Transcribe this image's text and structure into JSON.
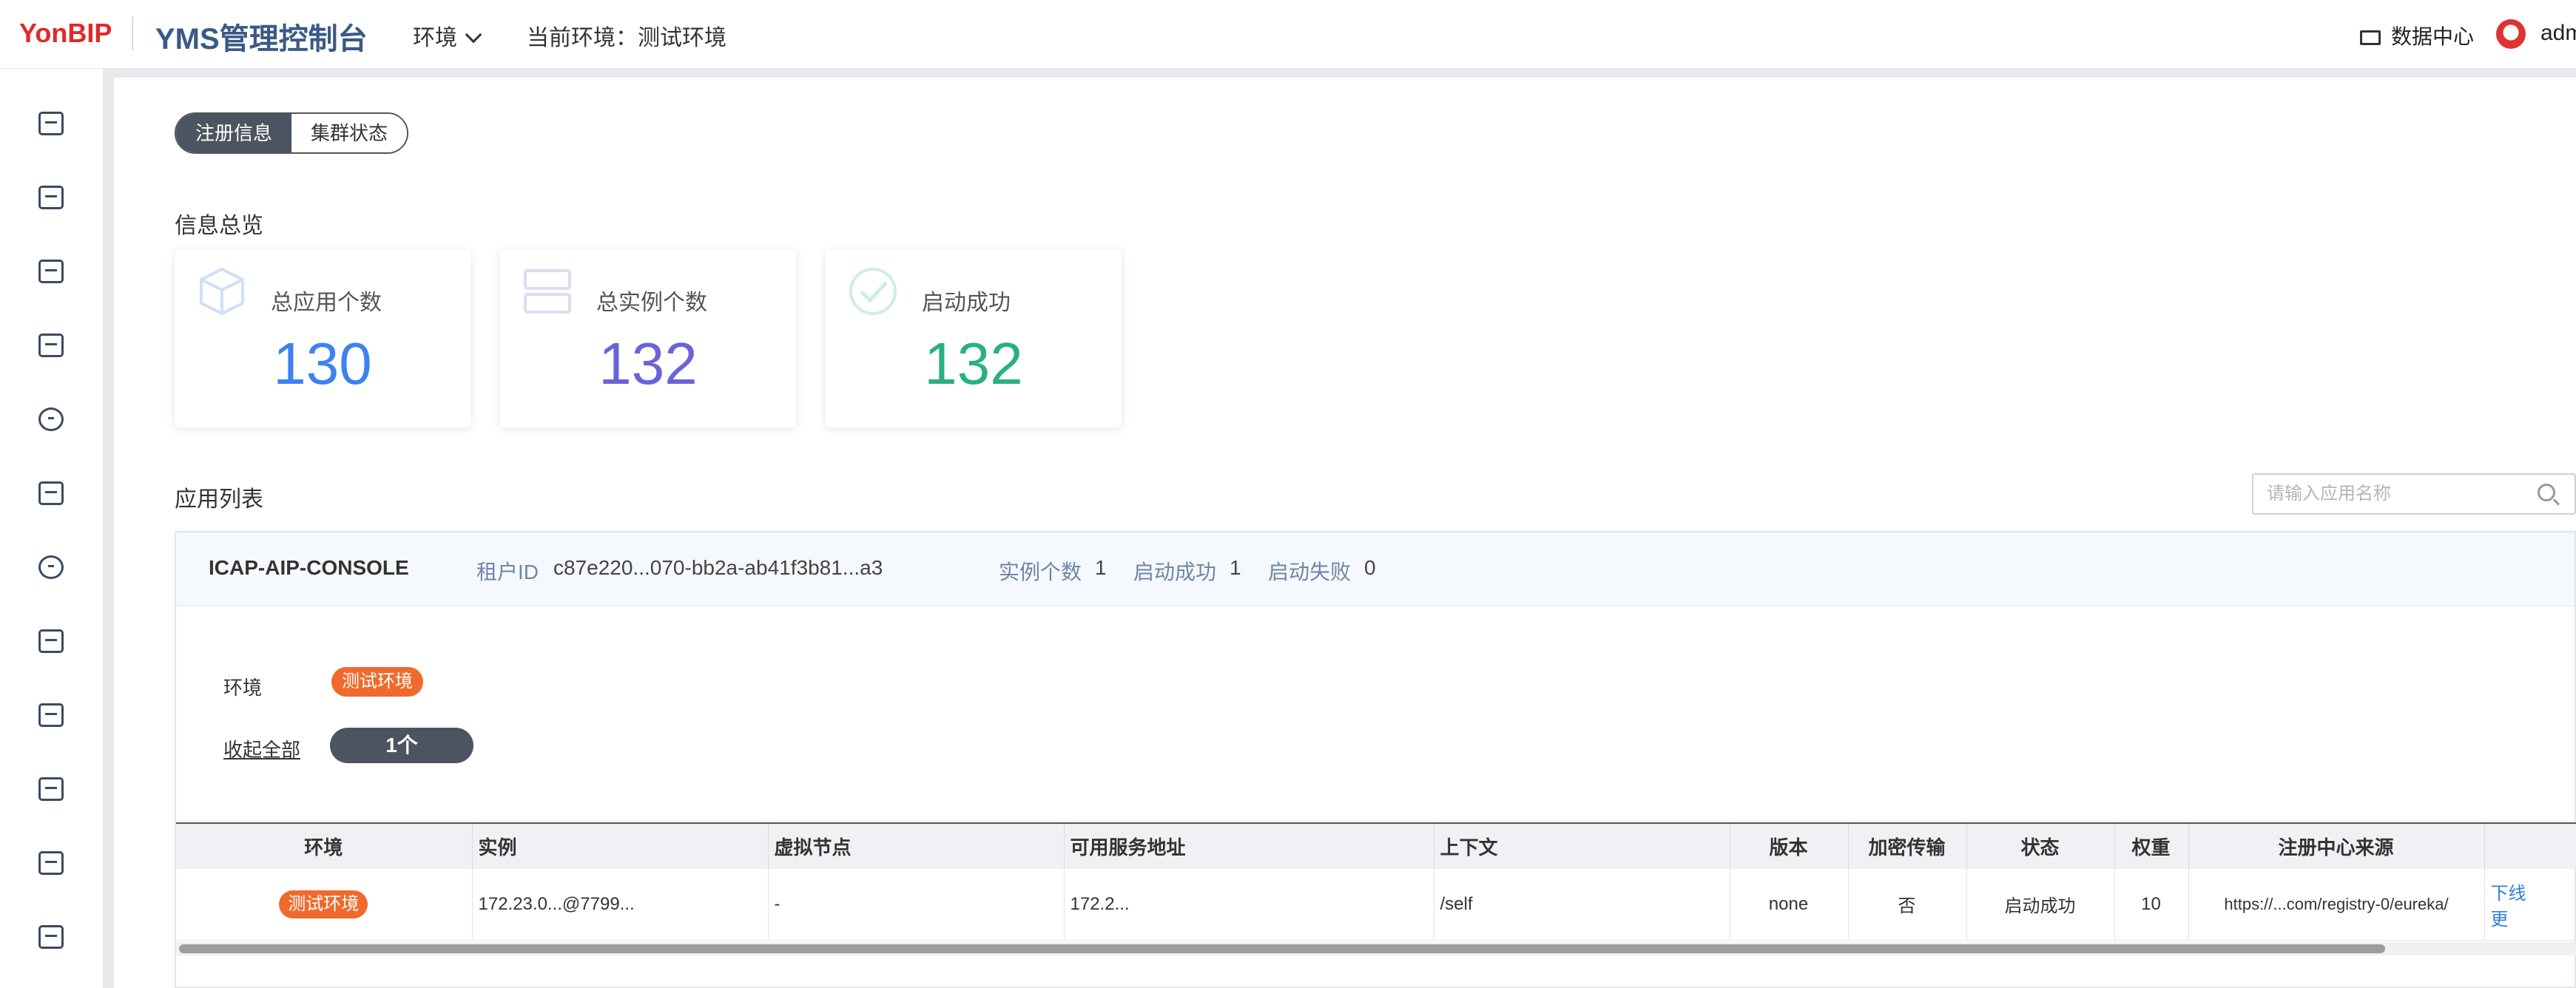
{
  "header": {
    "logo_text": "YonBIP",
    "app_title": "YMS管理控制台",
    "env_menu_label": "环境",
    "current_env_label": "当前环境：测试环境",
    "data_center_label": "数据中心",
    "user_label": "adm"
  },
  "sidebar": {
    "icons": [
      "monitor-icon",
      "chip-settings-icon",
      "server-icon",
      "layers-icon",
      "leaf-icon",
      "list-icon",
      "cluster-icon",
      "search-list-icon",
      "table-icon",
      "sliders-icon",
      "document-icon",
      "chart-icon"
    ]
  },
  "tabs": [
    {
      "label": "注册信息",
      "active": true
    },
    {
      "label": "集群状态",
      "active": false
    }
  ],
  "overview": {
    "title": "信息总览",
    "cards": [
      {
        "label": "总应用个数",
        "value": "130",
        "color": "#3d82f0",
        "icon": "cube-icon"
      },
      {
        "label": "总实例个数",
        "value": "132",
        "color": "#6a63d8",
        "icon": "server-stack-icon"
      },
      {
        "label": "启动成功",
        "value": "132",
        "color": "#2bb07f",
        "icon": "check-circle-icon"
      }
    ]
  },
  "app_list": {
    "title": "应用列表",
    "search_placeholder": "请输入应用名称"
  },
  "app": {
    "name": "ICAP-AIP-CONSOLE",
    "tenant_label": "租户ID",
    "tenant_value": "c87e220...070-bb2a-ab41f3b81...a3",
    "instances_label": "实例个数",
    "instances_value": "1",
    "success_label": "启动成功",
    "success_value": "1",
    "fail_label": "启动失败",
    "fail_value": "0",
    "env_label": "环境",
    "env_tag": "测试环境",
    "collapse_label": "收起全部",
    "count_pill": "1个"
  },
  "table": {
    "headers": [
      "环境",
      "实例",
      "虚拟节点",
      "可用服务地址",
      "上下文",
      "版本",
      "加密传输",
      "状态",
      "权重",
      "注册中心来源",
      ""
    ],
    "rows": [
      {
        "env": "测试环境",
        "instance": "172.23.0...@7799...",
        "vnode": "-",
        "address": "172.2...",
        "context": "/self",
        "version": "none",
        "encrypted": "否",
        "status": "启动成功",
        "weight": "10",
        "registry": "https://...com/registry-0/eureka/",
        "op_offline": "下线",
        "op_more": "更"
      }
    ]
  },
  "scrollbar": {
    "thumb_fraction": 0.92
  }
}
